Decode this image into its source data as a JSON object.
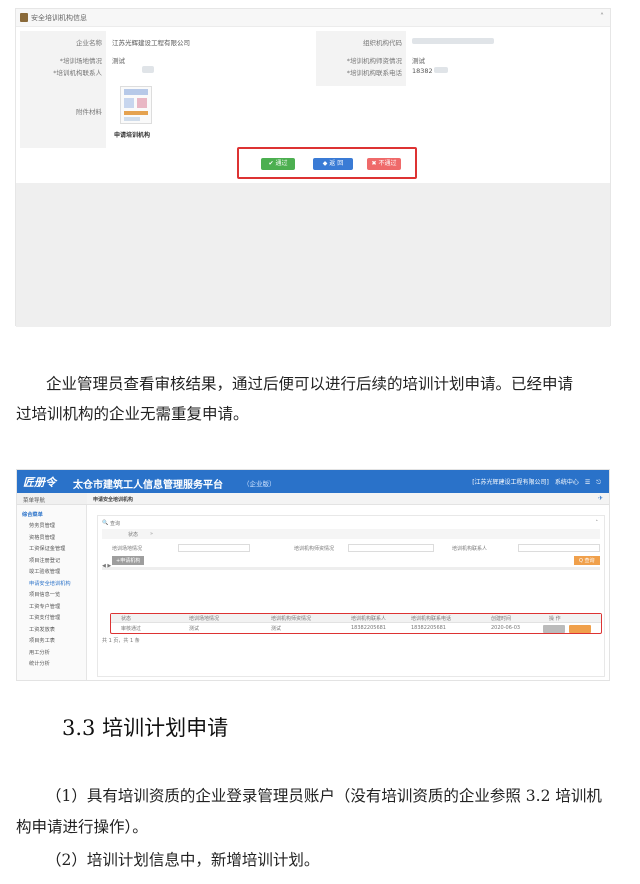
{
  "screenshot1": {
    "panel_title": "安全培训机构信息",
    "fields": [
      {
        "label": "企业名称",
        "value": "江苏光辉建设工程有限公司"
      },
      {
        "label": "*培训场地情况",
        "value": "测试"
      },
      {
        "label": "*培训机构联系人",
        "value": ""
      },
      {
        "label": "附件材料",
        "value": ""
      }
    ],
    "fields_right": [
      {
        "label": "组织机构代码",
        "value": ""
      },
      {
        "label": "*培训机构师资情况",
        "value": "测试"
      },
      {
        "label": "*培训机构联系电话",
        "value": "18382"
      }
    ],
    "attachment_caption": "申请培训机构",
    "buttons": {
      "approve": "✔ 通过",
      "back": "◆ 返 回",
      "reject": "✖ 不通过"
    }
  },
  "paragraph1": {
    "line1": "企业管理员查看审核结果，通过后便可以进行后续的培训计划申请。已经申请",
    "line2": "过培训机构的企业无需重复申请。"
  },
  "screenshot2": {
    "logo": "匠册令",
    "title": "太仓市建筑工人信息管理服务平台",
    "subtitle": "（企业版）",
    "top_right": "[江苏光辉建设工程有限公司]　系统中心　☰　⎋",
    "sidebar_header": "菜单导航",
    "menu_group": "综合菜单",
    "menu": [
      "劳务员管理",
      "资格员管理",
      "工资保证金管理",
      "项目注册登记",
      "竣工验收管理",
      "申请安全培训机构",
      "项目信息一览",
      "工资专户管理",
      "工资支付管理",
      "工资发放表",
      "项目务工表",
      "用工分析",
      "统计分析"
    ],
    "breadcrumb": "申请安全培训机构",
    "search_label": "查询",
    "status_label": "状态",
    "filters": [
      "培训场地情况",
      "培训机构师资情况",
      "培训机构联系人"
    ],
    "add_button": "+申请机构",
    "query_button": "Q 查询",
    "table_headers": [
      "状态",
      "培训场地情况",
      "培训机构师资情况",
      "培训机构联系人",
      "培训机构联系电话",
      "创建时间",
      "操 作"
    ],
    "table_row": [
      "审核通过",
      "测试",
      "测试",
      "18382205681",
      "18382205681",
      "2020-06-03",
      ""
    ],
    "pager": "共 1 页，共 1 条"
  },
  "heading": "3.3 培训计划申请",
  "paragraph2": {
    "line1": "（1）具有培训资质的企业登录管理员账户（没有培训资质的企业参照 3.2 培训机",
    "line2": "构申请进行操作）。"
  },
  "paragraph3": "（2）培训计划信息中，新增培训计划。",
  "colors": {
    "brand_blue": "#2a72c9",
    "approve": "#4caf50",
    "back": "#3a7bd5",
    "reject": "#ef6a6a",
    "highlight": "#dd3333"
  }
}
